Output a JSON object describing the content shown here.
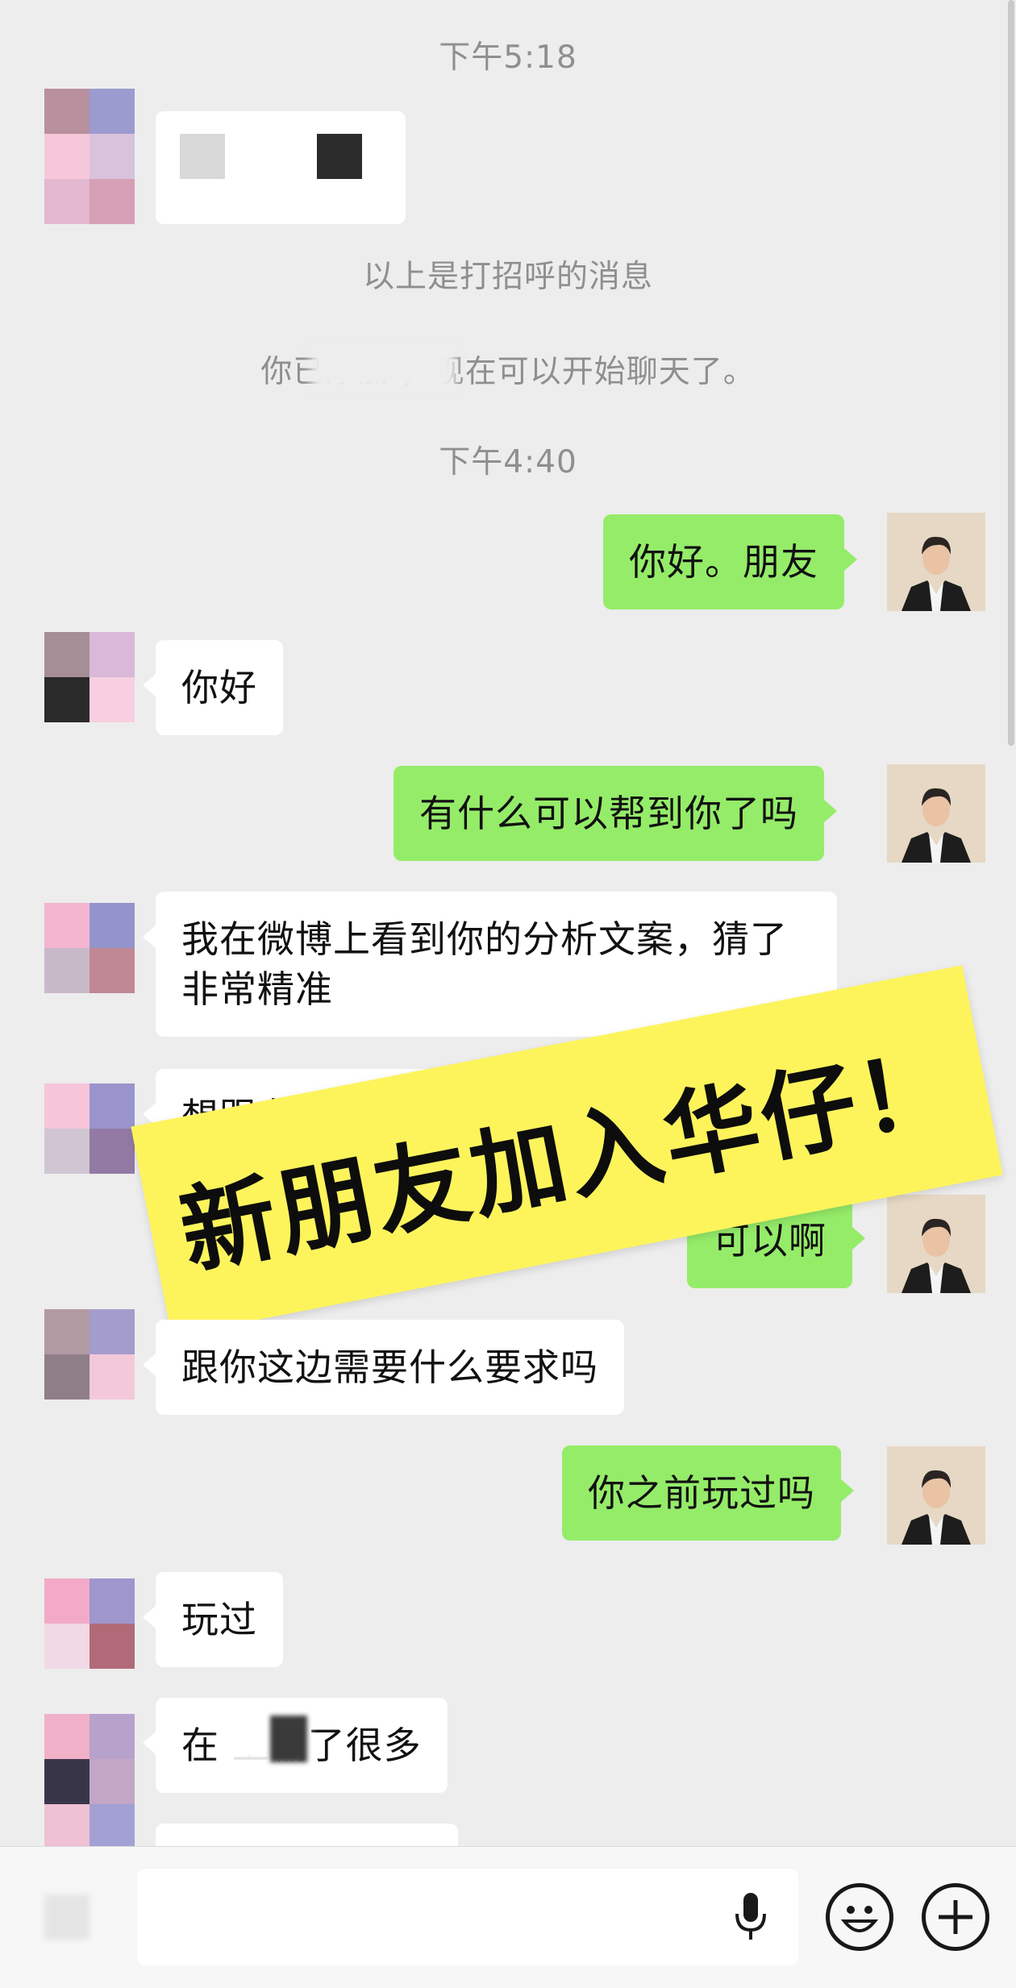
{
  "chat": {
    "time1": "下午5:18",
    "greeting_notice": "以上是打招呼的消息",
    "added_notice": "你已添加                ，现在可以开始聊天了。",
    "time2": "下午4:40",
    "messages": [
      {
        "side": "out",
        "text": "你好。朋友"
      },
      {
        "side": "in",
        "text": "你好"
      },
      {
        "side": "out",
        "text": "有什么可以帮到你了吗"
      },
      {
        "side": "in",
        "text": "我在微博上看到你的分析文案，猜了非常精准"
      },
      {
        "side": "in",
        "text": "想跟老师这边学习一下"
      },
      {
        "side": "out",
        "text": "可以啊"
      },
      {
        "side": "in",
        "text": "跟你这边需要什么要求吗"
      },
      {
        "side": "out",
        "text": "你之前玩过吗"
      },
      {
        "side": "in",
        "text": "玩过"
      },
      {
        "side": "in",
        "text": "在         上输了很多"
      }
    ]
  },
  "banner": {
    "text": "新朋友加入华仔！"
  },
  "input_bar": {
    "voice_icon": "microphone-icon",
    "emoji_icon": "smiley-icon",
    "plus_icon": "plus-icon"
  },
  "colors": {
    "background": "#ededed",
    "incoming_bubble": "#ffffff",
    "outgoing_bubble": "#95ec69",
    "banner": "#fdf45c"
  }
}
